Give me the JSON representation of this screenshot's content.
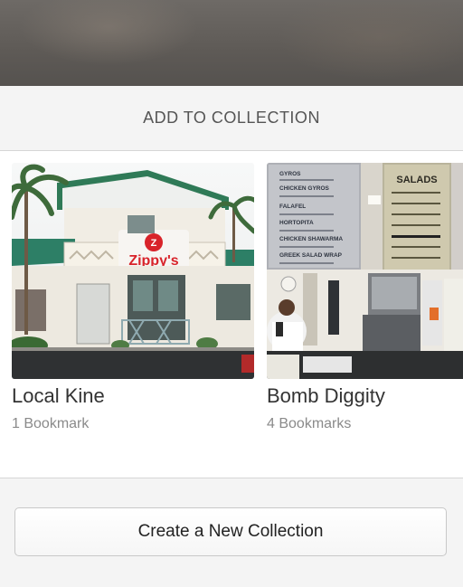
{
  "sheet": {
    "title": "ADD TO COLLECTION",
    "create_button_label": "Create a New Collection"
  },
  "collections": [
    {
      "name": "Local Kine",
      "count_label": "1 Bookmark",
      "photo_sign": "Zippy's"
    },
    {
      "name": "Bomb Diggity",
      "count_label": "4 Bookmarks",
      "menu_left": [
        "GYROS",
        "CHICKEN GYROS",
        "FALAFEL",
        "HORTOPITA",
        "CHICKEN SHAWARMA",
        "GREEK SALAD WRAP"
      ],
      "menu_right_title": "SALADS",
      "side_sign": "GY"
    }
  ]
}
